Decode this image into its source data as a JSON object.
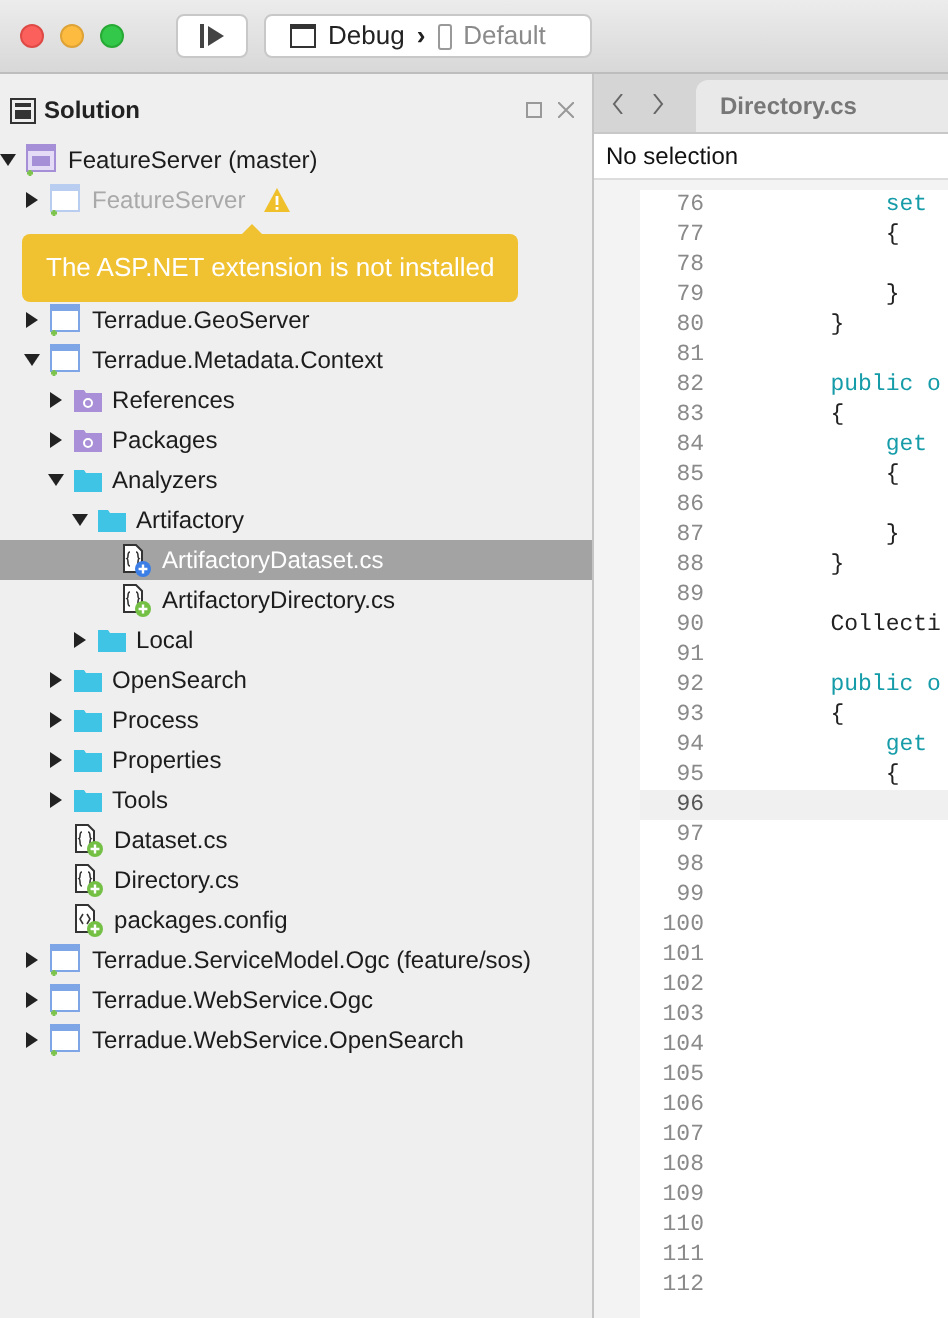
{
  "toolbar": {
    "config": "Debug",
    "separator": "›",
    "target": "Default"
  },
  "solution": {
    "title": "Solution",
    "tree": [
      {
        "label": "FeatureServer (master)",
        "kind": "solution",
        "expanded": true,
        "disabled": false,
        "children": [
          {
            "label": "FeatureServer",
            "kind": "project",
            "expanded": false,
            "disabled": true,
            "warning": true
          },
          {
            "kind": "hidden"
          },
          {
            "kind": "hidden"
          },
          {
            "label": "Terradue.GeoServer",
            "kind": "project",
            "expanded": false,
            "disabled": false
          },
          {
            "label": "Terradue.Metadata.Context",
            "kind": "project",
            "expanded": true,
            "disabled": false,
            "children": [
              {
                "label": "References",
                "kind": "special",
                "expanded": false
              },
              {
                "label": "Packages",
                "kind": "special",
                "expanded": false
              },
              {
                "label": "Analyzers",
                "kind": "folder",
                "expanded": true,
                "children": [
                  {
                    "label": "Artifactory",
                    "kind": "folder",
                    "expanded": true,
                    "children": [
                      {
                        "label": "ArtifactoryDataset.cs",
                        "kind": "csfile",
                        "color": "#3b7ee6",
                        "selected": true
                      },
                      {
                        "label": "ArtifactoryDirectory.cs",
                        "kind": "csfile",
                        "color": "#74c045",
                        "selected": false
                      }
                    ]
                  },
                  {
                    "label": "Local",
                    "kind": "folder",
                    "expanded": false
                  }
                ]
              },
              {
                "label": "OpenSearch",
                "kind": "folder",
                "expanded": false
              },
              {
                "label": "Process",
                "kind": "folder",
                "expanded": false
              },
              {
                "label": "Properties",
                "kind": "folder",
                "expanded": false
              },
              {
                "label": "Tools",
                "kind": "folder",
                "expanded": false
              },
              {
                "label": "Dataset.cs",
                "kind": "csfile",
                "color": "#74c045",
                "selected": false
              },
              {
                "label": "Directory.cs",
                "kind": "csfile",
                "color": "#74c045",
                "selected": false
              },
              {
                "label": "packages.config",
                "kind": "configfile",
                "color": "#74c045",
                "selected": false
              }
            ]
          },
          {
            "label": "Terradue.ServiceModel.Ogc (feature/sos)",
            "kind": "project",
            "expanded": false,
            "disabled": false
          },
          {
            "label": "Terradue.WebService.Ogc",
            "kind": "project",
            "expanded": false,
            "disabled": false
          },
          {
            "label": "Terradue.WebService.OpenSearch",
            "kind": "project",
            "expanded": false,
            "disabled": false
          }
        ]
      }
    ]
  },
  "tooltip": "The ASP.NET extension is not installed",
  "editor": {
    "tab": "Directory.cs",
    "breadcrumb": "No selection",
    "lines": [
      {
        "n": "76",
        "code": "            set",
        "kw": true
      },
      {
        "n": "77",
        "code": "            {"
      },
      {
        "n": "78"
      },
      {
        "n": "79",
        "code": "            }"
      },
      {
        "n": "80",
        "code": "        }"
      },
      {
        "n": "81"
      },
      {
        "n": "82",
        "code": "        public o",
        "kw": true
      },
      {
        "n": "83",
        "code": "        {"
      },
      {
        "n": "84",
        "code": "            get",
        "kw": true
      },
      {
        "n": "85",
        "code": "            {"
      },
      {
        "n": "86"
      },
      {
        "n": "87",
        "code": "            }"
      },
      {
        "n": "88",
        "code": "        }"
      },
      {
        "n": "89"
      },
      {
        "n": "90",
        "code": "        Collecti"
      },
      {
        "n": "91"
      },
      {
        "n": "92",
        "code": "        public o",
        "kw": true
      },
      {
        "n": "93",
        "code": "        {"
      },
      {
        "n": "94",
        "code": "            get",
        "kw": true
      },
      {
        "n": "95",
        "code": "            {"
      },
      {
        "n": "96",
        "current": true
      },
      {
        "n": "97"
      },
      {
        "n": "98"
      },
      {
        "n": "99"
      },
      {
        "n": "100"
      },
      {
        "n": "101"
      },
      {
        "n": "102"
      },
      {
        "n": "103"
      },
      {
        "n": "104"
      },
      {
        "n": "105"
      },
      {
        "n": "106"
      },
      {
        "n": "107"
      },
      {
        "n": "108"
      },
      {
        "n": "109"
      },
      {
        "n": "110"
      },
      {
        "n": "111"
      },
      {
        "n": "112"
      }
    ]
  }
}
